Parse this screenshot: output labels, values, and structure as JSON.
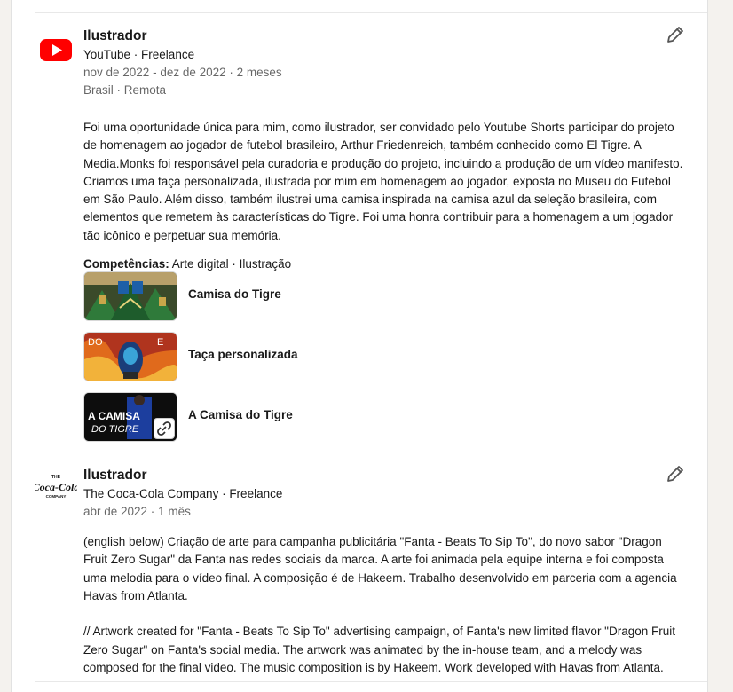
{
  "entries": [
    {
      "title": "Ilustrador",
      "company": "YouTube · Freelance",
      "dates": "nov de 2022 - dez de 2022 · 2 meses",
      "location": "Brasil · Remota",
      "description": "Foi uma oportunidade única para mim, como ilustrador, ser convidado pelo Youtube Shorts participar do projeto de homenagem ao jogador de futebol brasileiro, Arthur Friedenreich, também conhecido como El Tigre. A Media.Monks foi responsável pela curadoria e produção do projeto, incluindo a produção de um vídeo manifesto. Criamos uma taça personalizada, ilustrada por mim em homenagem ao jogador, exposta no Museu do Futebol em São Paulo. Além disso, também ilustrei uma camisa inspirada na camisa azul da seleção brasileira, com elementos que remetem às características do Tigre. Foi uma honra contribuir para a homenagem a um jogador tão icônico e perpetuar sua memória.",
      "skills_label": "Competências:",
      "skills": "Arte digital · Ilustração",
      "media": [
        {
          "label": "Camisa do Tigre"
        },
        {
          "label": "Taça personalizada"
        },
        {
          "label": "A Camisa do Tigre",
          "thumb_text_1": "A CAMISA",
          "thumb_text_2": "DO TIGRE"
        }
      ]
    },
    {
      "title": "Ilustrador",
      "company": "The Coca-Cola Company · Freelance",
      "dates": "abr de 2022 · 1 mês",
      "logo_top": "THE",
      "logo_text": "Coca-Cola",
      "logo_bottom": "COMPANY",
      "description": "(english below) Criação de arte para campanha publicitária \"Fanta - Beats To Sip To\", do novo sabor \"Dragon Fruit Zero Sugar\" da Fanta nas redes sociais da marca. A arte foi animada pela equipe interna e foi composta uma melodia para o vídeo final. A composição é de Hakeem. Trabalho desenvolvido em parceria com a agencia Havas from Atlanta.\n\n// Artwork created for \"Fanta - Beats To Sip To\" advertising campaign, of Fanta's new limited flavor \"Dragon Fruit Zero Sugar\" on Fanta's social media. The artwork was animated by the in-house team, and a melody was composed for the final video. The music composition is by Hakeem. Work developed with Havas from Atlanta."
    }
  ],
  "colors": {
    "youtube_red": "#ff0000",
    "divider": "#e8e8e8",
    "secondary_text": "#666666"
  },
  "icons": {
    "edit": "pencil-icon",
    "link": "link-icon"
  }
}
